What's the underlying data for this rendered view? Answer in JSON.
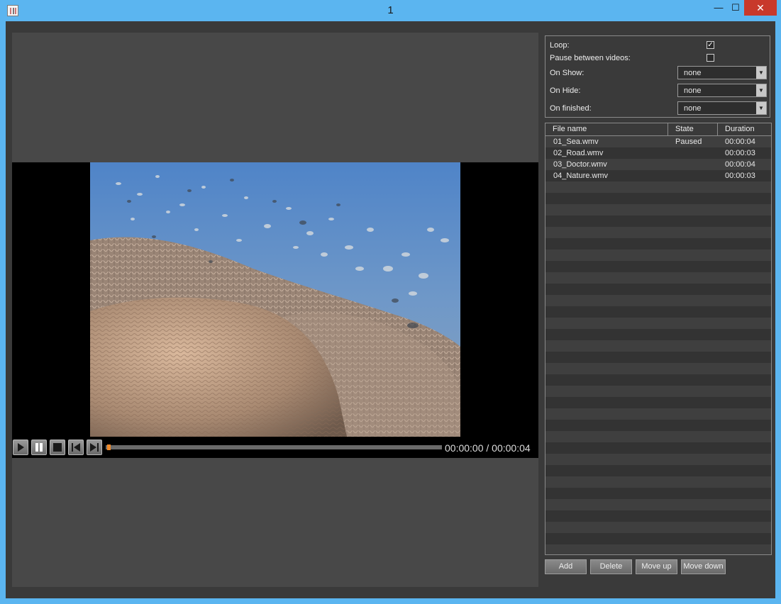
{
  "window": {
    "title": "1",
    "minimize_glyph": "—",
    "maximize_glyph": "☐",
    "close_glyph": "✕"
  },
  "player": {
    "time_display": "00:00:00 / 00:00:04",
    "progress": 0.0,
    "controls": [
      "play-icon",
      "pause-icon",
      "stop-icon",
      "skip-previous-icon",
      "skip-next-icon"
    ]
  },
  "settings": {
    "loop_label": "Loop:",
    "loop_checked": true,
    "pause_label": "Pause between videos:",
    "pause_checked": false,
    "on_show_label": "On Show:",
    "on_show_value": "none",
    "on_hide_label": "On Hide:",
    "on_hide_value": "none",
    "on_finished_label": "On finished:",
    "on_finished_value": "none",
    "check_glyph": "✓",
    "dropdown_glyph": "▼"
  },
  "playlist": {
    "columns": [
      "File name",
      "State",
      "Duration"
    ],
    "rows": [
      {
        "file": "01_Sea.wmv",
        "state": "Paused",
        "duration": "00:00:04"
      },
      {
        "file": "02_Road.wmv",
        "state": "",
        "duration": "00:00:03"
      },
      {
        "file": "03_Doctor.wmv",
        "state": "",
        "duration": "00:00:04"
      },
      {
        "file": "04_Nature.wmv",
        "state": "",
        "duration": "00:00:03"
      }
    ]
  },
  "buttons": {
    "add": "Add",
    "delete": "Delete",
    "move_up": "Move up",
    "move_down": "Move down"
  },
  "colors": {
    "accent_progress": "#f08a2a",
    "titlebar": "#5bb5f0",
    "close": "#c8392b"
  }
}
